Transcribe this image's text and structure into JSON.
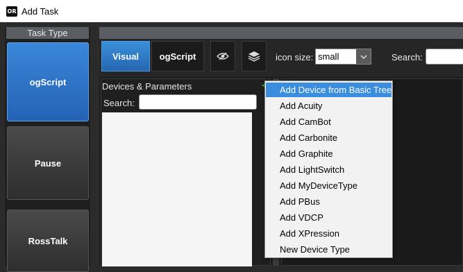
{
  "window": {
    "title": "Add Task",
    "icon": "app-logo-icon",
    "icon_text": "OR"
  },
  "task_type": {
    "header": "Task Type",
    "buttons": [
      {
        "label": "ogScript",
        "active": true
      },
      {
        "label": "Pause",
        "active": false
      },
      {
        "label": "RossTalk",
        "active": false
      }
    ]
  },
  "toolbar": {
    "tabs": [
      {
        "label": "Visual",
        "active": true
      },
      {
        "label": "ogScript",
        "active": false
      }
    ],
    "icon_size_label": "icon size:",
    "icon_size_value": "small",
    "search_label": "Search:",
    "search_value": ""
  },
  "devices_panel": {
    "title": "Devices & Parameters",
    "search_label": "Search:",
    "search_value": ""
  },
  "context_menu": {
    "items": [
      {
        "label": "Add Device from Basic Tree",
        "highlighted": true
      },
      {
        "label": "Add Acuity",
        "highlighted": false
      },
      {
        "label": "Add CamBot",
        "highlighted": false
      },
      {
        "label": "Add Carbonite",
        "highlighted": false
      },
      {
        "label": "Add Graphite",
        "highlighted": false
      },
      {
        "label": "Add LightSwitch",
        "highlighted": false
      },
      {
        "label": "Add MyDeviceType",
        "highlighted": false
      },
      {
        "label": "Add PBus",
        "highlighted": false
      },
      {
        "label": "Add VDCP",
        "highlighted": false
      },
      {
        "label": "Add XPression",
        "highlighted": false
      },
      {
        "label": "New Device Type",
        "highlighted": false
      }
    ]
  },
  "colors": {
    "accent": "#2f7fd1",
    "menu_highlight": "#3b8ede",
    "add_icon": "#33cc33"
  }
}
